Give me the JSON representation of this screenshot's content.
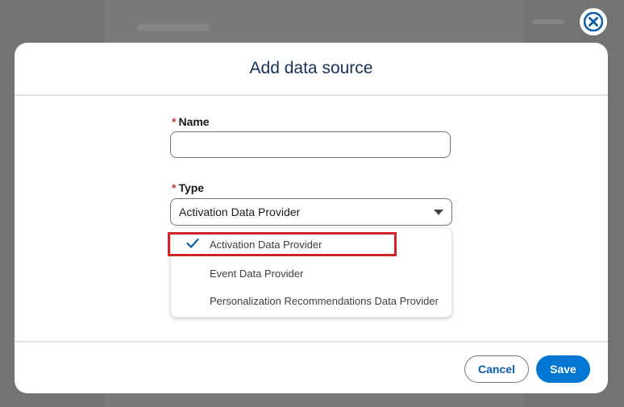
{
  "modal": {
    "title": "Add data source",
    "close_label": "close"
  },
  "form": {
    "name_label": "Name",
    "name_value": "",
    "name_placeholder": "",
    "type_label": "Type",
    "required_marker": "*",
    "type_selected": "Activation Data Provider",
    "type_options": [
      {
        "label": "Activation Data Provider",
        "selected": true
      },
      {
        "label": "Event Data Provider",
        "selected": false
      },
      {
        "label": "Personalization Recommendations Data Provider",
        "selected": false
      }
    ]
  },
  "footer": {
    "cancel_label": "Cancel",
    "save_label": "Save"
  },
  "colors": {
    "brand": "#0176d3",
    "title": "#16325c",
    "required": "#c23934",
    "highlight": "#d0232a"
  },
  "icons": {
    "close": "close-icon",
    "check": "check-icon",
    "caret": "chevron-down-icon"
  }
}
